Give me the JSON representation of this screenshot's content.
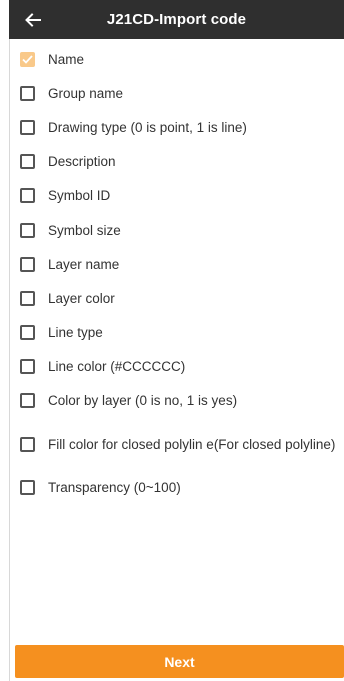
{
  "header": {
    "title": "J21CD-Import code",
    "back_icon": "arrow-left-icon"
  },
  "fields": [
    {
      "label": "Name",
      "checked": true
    },
    {
      "label": "Group name",
      "checked": false
    },
    {
      "label": "Drawing type (0 is point, 1 is line)",
      "checked": false
    },
    {
      "label": "Description",
      "checked": false
    },
    {
      "label": "Symbol ID",
      "checked": false
    },
    {
      "label": "Symbol size",
      "checked": false
    },
    {
      "label": "Layer name",
      "checked": false
    },
    {
      "label": "Layer color",
      "checked": false
    },
    {
      "label": "Line type",
      "checked": false
    },
    {
      "label": "Line color (#CCCCCC)",
      "checked": false
    },
    {
      "label": "Color by layer (0 is no, 1 is yes)",
      "checked": false
    },
    {
      "label": "Fill color for closed polylin e(For closed polyline)",
      "checked": false
    },
    {
      "label": "Transparency (0~100)",
      "checked": false
    }
  ],
  "footer": {
    "next_label": "Next"
  },
  "colors": {
    "header_bg": "#2f2f2f",
    "accent": "#f5901f",
    "checked_box": "#f9c98a"
  }
}
